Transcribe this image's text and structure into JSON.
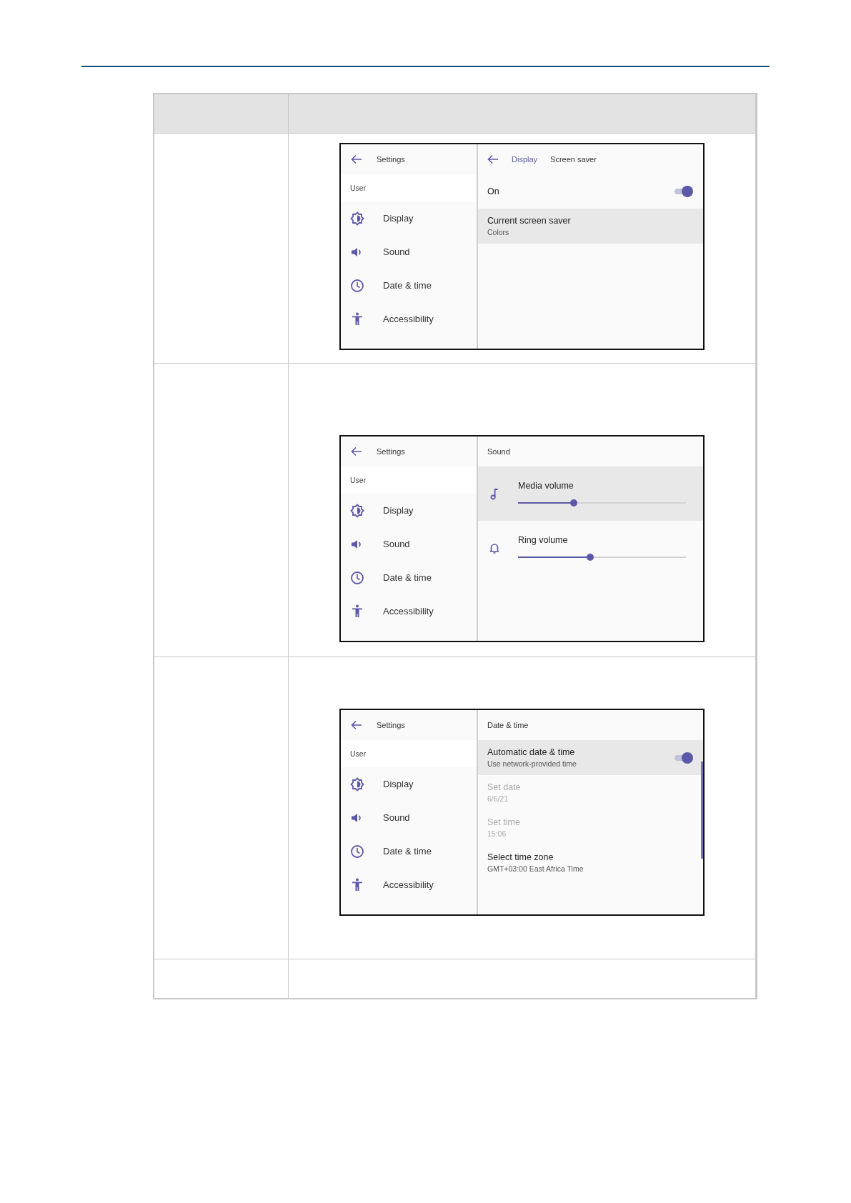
{
  "screenshots": [
    {
      "sidebar": {
        "back_label": "Settings",
        "section": "User",
        "items": [
          {
            "label": "Display"
          },
          {
            "label": "Sound"
          },
          {
            "label": "Date & time"
          },
          {
            "label": "Accessibility"
          }
        ]
      },
      "pane": {
        "back": true,
        "crumbs": [
          {
            "label": "Display",
            "link": true
          },
          {
            "label": "Screen saver",
            "link": false
          }
        ],
        "scrollbar": false,
        "rows": [
          {
            "kind": "toggle",
            "title": "On",
            "on": true,
            "highlighted": false,
            "disabled": false
          },
          {
            "kind": "text",
            "title": "Current screen saver",
            "subtitle": "Colors",
            "highlighted": true,
            "disabled": false
          }
        ]
      }
    },
    {
      "sidebar": {
        "back_label": "Settings",
        "section": "User",
        "items": [
          {
            "label": "Display"
          },
          {
            "label": "Sound"
          },
          {
            "label": "Date & time"
          },
          {
            "label": "Accessibility"
          }
        ]
      },
      "pane": {
        "back": false,
        "crumbs": [
          {
            "label": "Sound",
            "link": false
          }
        ],
        "scrollbar": false,
        "rows": [
          {
            "kind": "slider",
            "title": "Media volume",
            "level": 0.33,
            "highlighted": true,
            "disabled": false
          },
          {
            "kind": "slider",
            "title": "Ring volume",
            "level": 0.43,
            "highlighted": false,
            "disabled": false
          }
        ]
      }
    },
    {
      "sidebar": {
        "back_label": "Settings",
        "section": "User",
        "items": [
          {
            "label": "Display"
          },
          {
            "label": "Sound"
          },
          {
            "label": "Date & time"
          },
          {
            "label": "Accessibility"
          }
        ]
      },
      "pane": {
        "back": false,
        "crumbs": [
          {
            "label": "Date & time",
            "link": false
          }
        ],
        "scrollbar": true,
        "rows": [
          {
            "kind": "toggle",
            "title": "Automatic date & time",
            "subtitle": "Use network-provided time",
            "on": true,
            "highlighted": true,
            "disabled": false
          },
          {
            "kind": "text",
            "title": "Set date",
            "subtitle": "6/6/21",
            "highlighted": false,
            "disabled": true
          },
          {
            "kind": "text",
            "title": "Set time",
            "subtitle": "15:06",
            "highlighted": false,
            "disabled": true
          },
          {
            "kind": "text",
            "title": "Select time zone",
            "subtitle": "GMT+03:00 East Africa Time",
            "highlighted": false,
            "disabled": false
          }
        ]
      }
    }
  ]
}
